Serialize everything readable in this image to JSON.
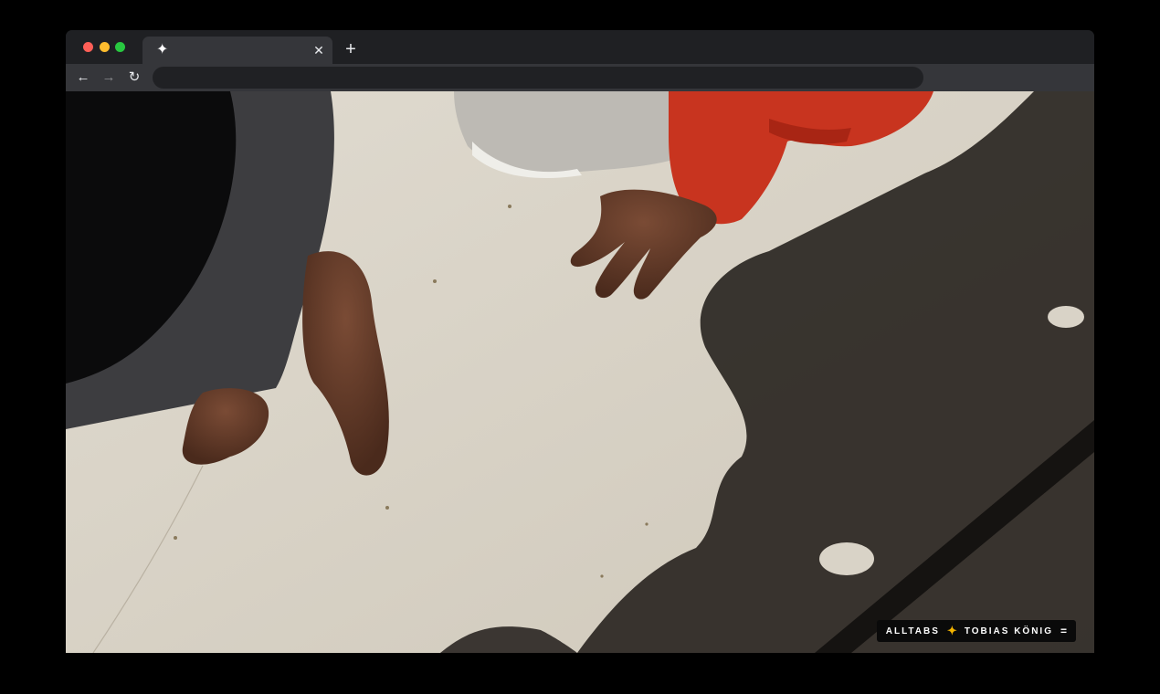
{
  "browser": {
    "tab": {
      "favicon_icon": "sparkle-icon",
      "favicon_glyph": "✦",
      "close_glyph": "✕"
    },
    "new_tab_glyph": "+",
    "nav": {
      "back_glyph": "←",
      "forward_glyph": "→",
      "reload_glyph": "↻"
    },
    "address": ""
  },
  "badge": {
    "left_text": "ALLTABS",
    "star_glyph": "✦",
    "right_text": "TOBIAS KÖNIG",
    "menu_glyph": "="
  },
  "colors": {
    "page_bg": "#000000",
    "tabbar": "#1f2023",
    "toolbar": "#35363a",
    "badge_star": "#f4b400",
    "sleeve_red": "#c8341f"
  }
}
